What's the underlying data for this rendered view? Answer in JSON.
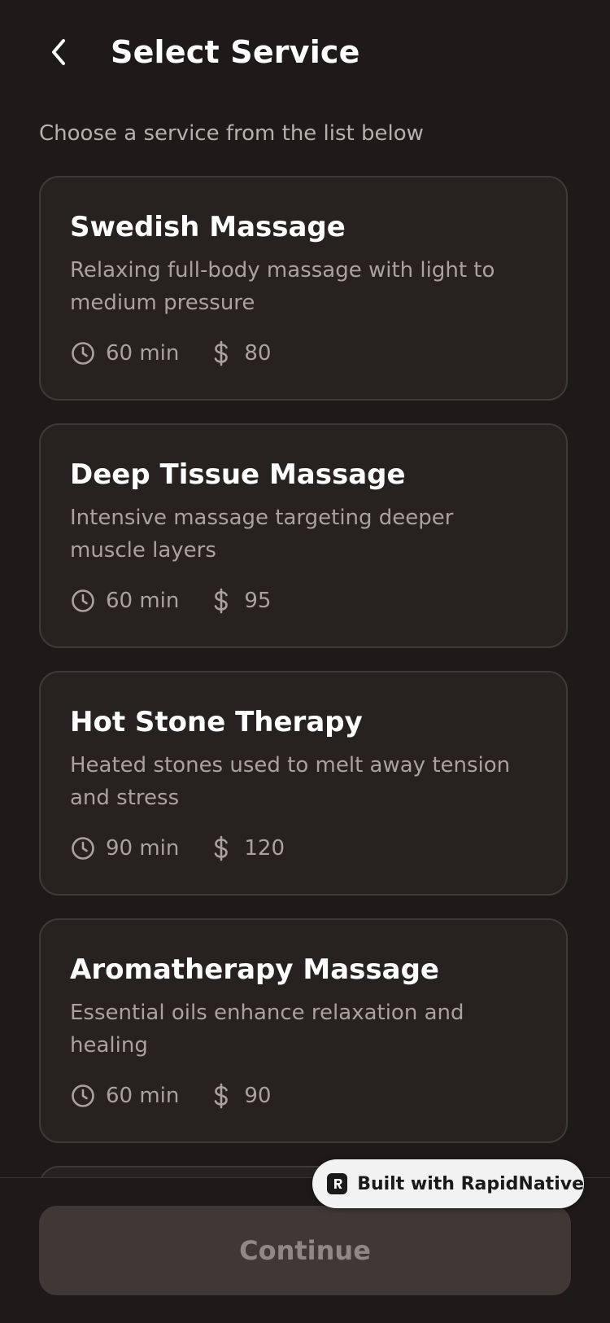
{
  "header": {
    "title": "Select Service",
    "back_icon": "chevron-left-icon"
  },
  "subtitle": "Choose a service from the list below",
  "services": [
    {
      "name": "Swedish Massage",
      "description": "Relaxing full-body massage with light to medium pressure",
      "duration": "60 min",
      "price": "80"
    },
    {
      "name": "Deep Tissue Massage",
      "description": "Intensive massage targeting deeper muscle layers",
      "duration": "60 min",
      "price": "95"
    },
    {
      "name": "Hot Stone Therapy",
      "description": "Heated stones used to melt away tension and stress",
      "duration": "90 min",
      "price": "120"
    },
    {
      "name": "Aromatherapy Massage",
      "description": "Essential oils enhance relaxation and healing",
      "duration": "60 min",
      "price": "90"
    }
  ],
  "footer": {
    "continue_label": "Continue"
  },
  "badge": {
    "label": "Built with RapidNative"
  },
  "colors": {
    "background": "#1d1a19",
    "card_background": "#272220",
    "card_border": "#3f3937",
    "button_disabled": "#403835"
  }
}
